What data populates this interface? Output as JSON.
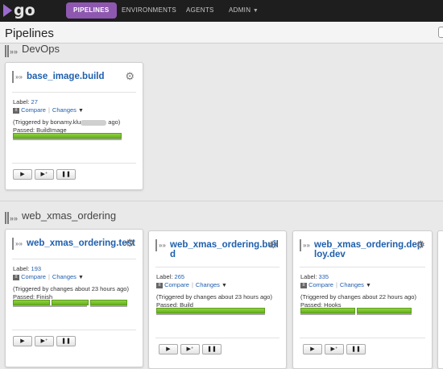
{
  "app": {
    "logo_text": "go",
    "brand_color": "#8e58b0"
  },
  "nav": {
    "pipelines": "PIPELINES",
    "environments": "ENVIRONMENTS",
    "agents": "AGENTS",
    "admin": "ADMIN",
    "admin_caret": "▼"
  },
  "page": {
    "title": "Pipelines"
  },
  "common": {
    "label_prefix": "Label:",
    "compare": "Compare",
    "changes": "Changes",
    "changes_caret": "▼",
    "divider": "|",
    "plus_minus": "±",
    "gear": "⚙",
    "flag_arrows": "»»",
    "play": "▶",
    "play_plus": "▶⁺",
    "pause": "❚❚"
  },
  "groups": [
    {
      "name": "DevOps",
      "pipelines": [
        {
          "name": "base_image.build",
          "label": "27",
          "triggered": "(Triggered by bonamy.klu",
          "triggered_after": " ago)",
          "passed": "Passed: BuildImage",
          "stages": [
            1.0
          ]
        }
      ]
    },
    {
      "name": "web_xmas_ordering",
      "pipelines": [
        {
          "name": "web_xmas_ordering.test",
          "label": "193",
          "triggered": "(Triggered by changes about 23 hours ago)",
          "passed": "Passed: Finish",
          "stages": [
            1,
            1,
            1
          ]
        },
        {
          "name_line1": "web_xmas_ordering.buil",
          "name_line2": "d",
          "label": "265",
          "triggered": "(Triggered by changes about 23 hours ago)",
          "passed": "Passed: Build",
          "stages": [
            1
          ]
        },
        {
          "name_line1": "web_xmas_ordering.dep",
          "name_line2": "loy.dev",
          "label": "335",
          "triggered": "(Triggered by changes about 22 hours ago)",
          "passed": "Passed: Hooks",
          "stages": [
            1,
            1
          ]
        }
      ]
    }
  ]
}
